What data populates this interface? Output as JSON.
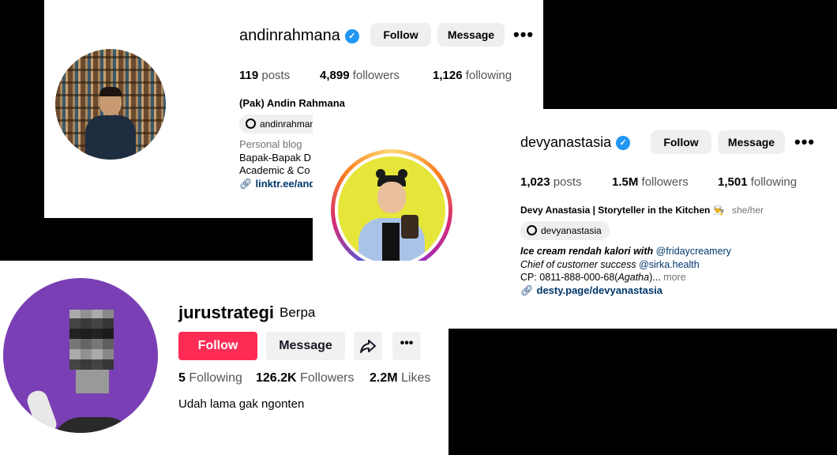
{
  "andin": {
    "username": "andinrahmana",
    "follow_label": "Follow",
    "message_label": "Message",
    "more_label": "•••",
    "posts_count": "119",
    "posts_label": "posts",
    "followers_count": "4,899",
    "followers_label": "followers",
    "following_count": "1,126",
    "following_label": "following",
    "display_name": "(Pak) Andin Rahmana",
    "threads_handle": "andinrahman",
    "category": "Personal blog",
    "bio_line1": "Bapak-Bapak D",
    "bio_line2": "Academic & Co",
    "link": "linktr.ee/and"
  },
  "devy": {
    "username": "devyanastasia",
    "follow_label": "Follow",
    "message_label": "Message",
    "more_label": "•••",
    "posts_count": "1,023",
    "posts_label": "posts",
    "followers_count": "1.5M",
    "followers_label": "followers",
    "following_count": "1,501",
    "following_label": "following",
    "display_name": "Devy Anastasia | Storyteller in the Kitchen",
    "emoji": "👨‍🍳",
    "pronouns": "she/her",
    "threads_handle": "devyanastasia",
    "bio_line1_text": "Ice cream rendah kalori with ",
    "bio_line1_mention": "@fridaycreamery",
    "bio_line2_text": "Chief of customer success ",
    "bio_line2_mention": "@sirka.health",
    "bio_line3_text": "CP: 0811-888-000-68(",
    "bio_line3_italic": "Agatha",
    "bio_line3_end": ")...",
    "more_text": "more",
    "link": "desty.page/devyanastasia"
  },
  "juru": {
    "username": "jurustrategi",
    "display_name_partial": "Berpa",
    "follow_label": "Follow",
    "message_label": "Message",
    "following_count": "5",
    "following_label": "Following",
    "followers_count": "126.2K",
    "followers_label": "Followers",
    "likes_count": "2.2M",
    "likes_label": "Likes",
    "bio": "Udah lama gak ngonten"
  }
}
